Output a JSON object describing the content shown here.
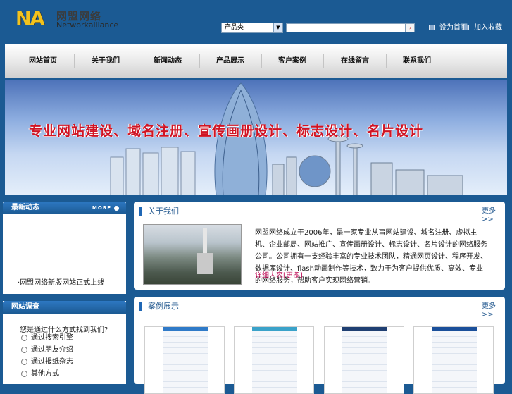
{
  "brand": {
    "mark": "NA",
    "cn": "网盟网络",
    "en": "Networkalliance"
  },
  "search": {
    "category": "产品类",
    "value": "",
    "placeholder": "",
    "go": "›"
  },
  "toplinks": [
    {
      "label": "设为首页"
    },
    {
      "label": "加入收藏"
    }
  ],
  "nav": [
    "网站首页",
    "关于我们",
    "新闻动态",
    "产品展示",
    "客户案例",
    "在线留言",
    "联系我们"
  ],
  "banner": {
    "text": "专业网站建设、域名注册、宣传画册设计、标志设计、名片设计"
  },
  "news": {
    "title": "最新动态",
    "more": "MORE",
    "items": [
      "网盟网络新版网站正式上线"
    ]
  },
  "survey": {
    "title": "网站调查",
    "question": "您是通过什么方式找到我们?",
    "options": [
      "通过搜索引擎",
      "通过朋友介绍",
      "通过报纸杂志",
      "其他方式"
    ]
  },
  "about": {
    "title": "关于我们",
    "more": "更多>>",
    "text": "网盟网络成立于2006年，是一家专业从事网站建设、域名注册、虚拟主机、企业邮局、网站推广、宣传画册设计、标志设计、名片设计的网络服务公司。公司拥有一支经验丰富的专业技术团队，精通网页设计、程序开发、数据库设计、flash动画制作等技术，致力于为客户提供优质、高效、专业的网络服务，帮助客户实现网络营销。",
    "readmore": "详细内容[更多]"
  },
  "cases": {
    "title": "案例展示",
    "more": "更多>>",
    "thumbs": [
      "#2f7ac8",
      "#3aa2c9",
      "#1f3f72",
      "#1a4f9a"
    ]
  }
}
